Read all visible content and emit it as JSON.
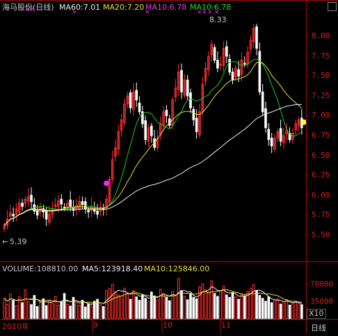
{
  "header": {
    "stock_label": "海马股份(日线)",
    "ma60_label": "MA60:7.01",
    "ma20_label": "MA20:7.20",
    "ma10a_label": "MA10:6.78",
    "ma10b_label": "MA10:6.78",
    "peak_label": "8.33",
    "low_label": "5.39"
  },
  "volume_header": {
    "volume_label": "VOLUME:108810.00",
    "ma5_label": "MA5:123918.40",
    "ma10_label": "MA10:125846.00"
  },
  "x10_button": "X10",
  "period_button": "日线",
  "x_labels": [
    "2010年",
    "9",
    "10",
    "11"
  ],
  "price_ticks": [
    "8.00",
    "7.75",
    "7.50",
    "7.25",
    "7.00",
    "6.75",
    "6.50",
    "6.25",
    "6.00",
    "5.75",
    "5.50"
  ],
  "volume_ticks": [
    "70000",
    "35000"
  ],
  "colors": {
    "up": "#ff3030",
    "down": "#ffffff",
    "ma_green": "#10d010",
    "ma_yellow": "#e8e030",
    "ma_white": "#f0f0f0",
    "separator": "#a01010",
    "magenta": "#ff20ff"
  },
  "chart_data": [
    {
      "type": "candlestick",
      "title": "海马股份(日线)",
      "ylim": [
        5.2,
        8.3
      ],
      "y_ticks": [
        5.5,
        5.75,
        6.0,
        6.25,
        6.5,
        6.75,
        7.0,
        7.25,
        7.5,
        7.75,
        8.0
      ],
      "annotations": [
        {
          "text": "8.33",
          "kind": "high"
        },
        {
          "text": "5.39",
          "kind": "low"
        }
      ],
      "closes": [
        5.62,
        5.7,
        5.78,
        5.74,
        5.83,
        5.9,
        5.86,
        5.95,
        5.98,
        5.92,
        5.8,
        5.75,
        5.85,
        5.79,
        5.7,
        5.76,
        5.82,
        5.88,
        5.93,
        5.89,
        5.84,
        5.9,
        5.86,
        5.81,
        5.87,
        5.92,
        5.88,
        5.83,
        5.79,
        5.86,
        5.8,
        5.76,
        5.85,
        5.82,
        5.95,
        6.2,
        6.45,
        6.6,
        6.8,
        6.95,
        7.15,
        7.25,
        7.1,
        7.3,
        7.2,
        7.05,
        6.9,
        6.7,
        6.85,
        6.75,
        6.6,
        6.72,
        6.9,
        7.05,
        7.0,
        6.88,
        7.2,
        7.35,
        7.55,
        7.3,
        7.45,
        7.25,
        7.1,
        6.95,
        6.8,
        7.05,
        7.4,
        7.6,
        7.75,
        7.9,
        7.7,
        7.6,
        7.65,
        7.85,
        7.75,
        7.55,
        7.45,
        7.6,
        7.5,
        7.7,
        7.65,
        7.8,
        7.95,
        8.1,
        7.85,
        7.3,
        7.05,
        6.85,
        6.7,
        6.62,
        6.72,
        6.8,
        6.68,
        6.75,
        6.82,
        6.7,
        6.78,
        6.9,
        6.95,
        6.85
      ]
    },
    {
      "type": "bar",
      "title": "VOLUME",
      "ylim": [
        0,
        95000
      ],
      "y_ticks": [
        35000,
        70000
      ],
      "values": [
        42000,
        30000,
        51000,
        38000,
        27000,
        45000,
        33000,
        60000,
        36000,
        29000,
        48000,
        25000,
        34000,
        41000,
        27000,
        39000,
        31000,
        46000,
        28000,
        35000,
        52000,
        30000,
        26000,
        44000,
        33000,
        28000,
        38000,
        24000,
        31000,
        27000,
        36000,
        40000,
        29000,
        25000,
        58000,
        62000,
        71000,
        55000,
        49000,
        47000,
        63000,
        52000,
        40000,
        58000,
        45000,
        38000,
        50000,
        42000,
        36000,
        55000,
        47000,
        39000,
        61000,
        52000,
        44000,
        37000,
        56000,
        49000,
        83000,
        58000,
        46000,
        39000,
        52000,
        44000,
        41000,
        66000,
        72000,
        60000,
        55000,
        78000,
        52000,
        46000,
        58000,
        67000,
        49000,
        44000,
        53000,
        45000,
        40000,
        51000,
        47000,
        56000,
        62000,
        70000,
        58000,
        48000,
        42000,
        36000,
        45000,
        33000,
        38000,
        41000,
        30000,
        35000,
        39000,
        28000,
        33000,
        36000,
        31000,
        29000
      ]
    }
  ]
}
